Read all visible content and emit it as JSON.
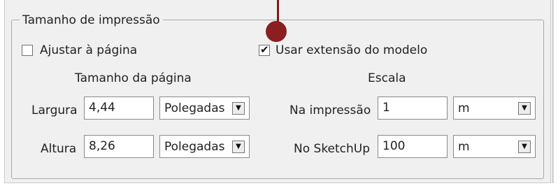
{
  "group": {
    "title": "Tamanho de impressão"
  },
  "checkboxes": {
    "fit_page": {
      "label": "Ajustar à página",
      "checked": false
    },
    "use_model_extents": {
      "label": "Usar extensão do modelo",
      "checked": true
    }
  },
  "page_size": {
    "heading": "Tamanho da página",
    "width_label": "Largura",
    "width_value": "4,44",
    "width_unit": "Polegadas",
    "height_label": "Altura",
    "height_value": "8,26",
    "height_unit": "Polegadas"
  },
  "scale": {
    "heading": "Escala",
    "print_label": "Na impressão",
    "print_value": "1",
    "print_unit": "m",
    "model_label": "No SketchUp",
    "model_value": "100",
    "model_unit": "m"
  },
  "colors": {
    "annotation_marker": "#8b1e1e",
    "panel_bg": "#f0f0f0"
  }
}
